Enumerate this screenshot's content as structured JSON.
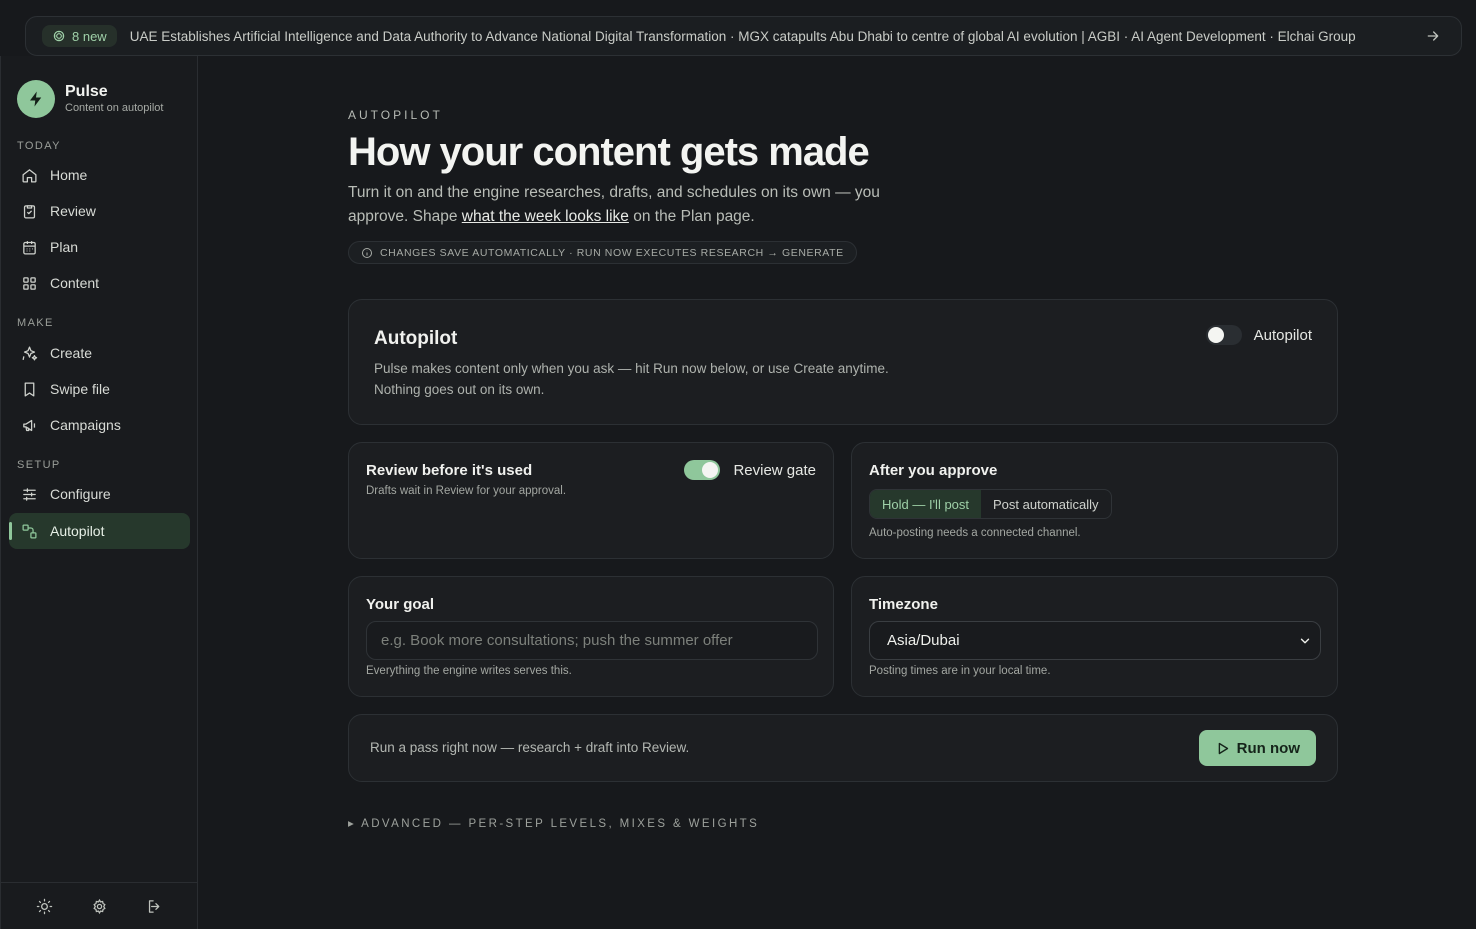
{
  "ticker": {
    "badge": "8 new",
    "headline": "UAE Establishes Artificial Intelligence and Data Authority to Advance National Digital Transformation · MGX catapults Abu Dhabi to centre of global AI evolution | AGBI · AI Agent Development · Elchai Group"
  },
  "brand": {
    "name": "Pulse",
    "tagline": "Content on autopilot"
  },
  "sidebar": {
    "sections": {
      "today": "TODAY",
      "make": "MAKE",
      "setup": "SETUP"
    },
    "items": {
      "home": "Home",
      "review": "Review",
      "plan": "Plan",
      "content": "Content",
      "create": "Create",
      "swipe": "Swipe file",
      "campaigns": "Campaigns",
      "configure": "Configure",
      "autopilot": "Autopilot"
    },
    "active": "autopilot"
  },
  "page": {
    "eyebrow": "AUTOPILOT",
    "title": "How your content gets made",
    "intro_before": "Turn it on and the engine researches, drafts, and schedules on its own — you approve. Shape ",
    "intro_link": "what the week looks like",
    "intro_after": " on the Plan page.",
    "info": "CHANGES SAVE AUTOMATICALLY · RUN NOW EXECUTES RESEARCH → GENERATE"
  },
  "autopilot_card": {
    "title": "Autopilot",
    "toggle_label": "Autopilot",
    "toggle_on": false,
    "description_line1": "Pulse makes content only when you ask — hit Run now below, or use Create anytime.",
    "description_line2": "Nothing goes out on its own."
  },
  "review_card": {
    "title": "Review before it's used",
    "hint": "Drafts wait in Review for your approval.",
    "toggle_label": "Review gate",
    "toggle_on": true
  },
  "approve_card": {
    "title": "After you approve",
    "options": [
      "Hold — I'll post",
      "Post automatically"
    ],
    "selected": "Hold — I'll post",
    "hint": "Auto-posting needs a connected channel."
  },
  "goal_card": {
    "title": "Your goal",
    "placeholder": "e.g. Book more consultations; push the summer offer",
    "hint": "Everything the engine writes serves this."
  },
  "timezone_card": {
    "title": "Timezone",
    "value": "Asia/Dubai",
    "hint": "Posting times are in your local time."
  },
  "run_card": {
    "text": "Run a pass right now — research + draft into Review.",
    "button": "Run now"
  },
  "advanced": "▸ ADVANCED — PER-STEP LEVELS, MIXES & WEIGHTS",
  "colors": {
    "accent": "#8fc79b",
    "background": "#17191c",
    "card": "#1c1e21"
  }
}
